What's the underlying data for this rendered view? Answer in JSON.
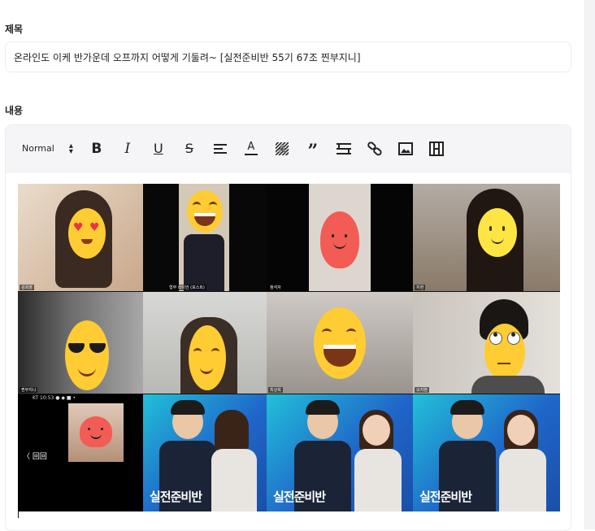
{
  "form": {
    "title_label": "제목",
    "title_value": "온라인도 이케 반가운데 오프까지 어떻게 기둘려~ [실전준비반 55기 67조 찐부지니]",
    "content_label": "내용"
  },
  "toolbar": {
    "format_value": "Normal",
    "buttons": {
      "bold": "B",
      "italic": "I",
      "underline": "U",
      "strike": "S",
      "align": "align",
      "color": "A",
      "background": "A",
      "quote": "”",
      "divider": "divider",
      "link": "link",
      "image": "image",
      "video": "video"
    }
  },
  "image": {
    "top_row_labels": [
      "김희영",
      "형부 라이언 (포스트)",
      "참석자",
      "지현"
    ],
    "mid_row_labels": [
      "찐부지니",
      "",
      "최상희",
      "오지현"
    ],
    "phone_status": "KT 10:53 ● ◆ ■ •",
    "back_label": "〈 回回",
    "banner_text": "실전준비반"
  },
  "colors": {
    "banner_blue": "#1f66c9",
    "banner_cyan": "#22c1d9",
    "heart_face": "#f25c55",
    "emoji_yellow": "#ffcc33"
  }
}
